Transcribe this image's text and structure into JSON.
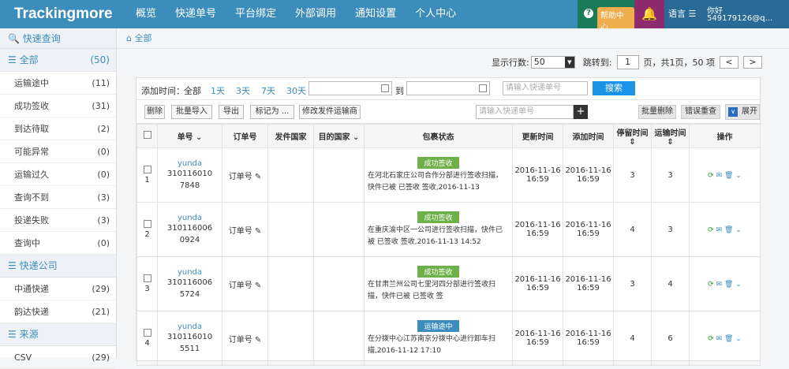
{
  "header": {
    "logo": "Trackingmore",
    "nav": [
      "概览",
      "快递单号",
      "平台绑定",
      "外部调用",
      "通知设置",
      "个人中心"
    ],
    "help": "帮助中心",
    "lang": "语言",
    "user_greeting": "你好",
    "user_email": "549179126@q..."
  },
  "sidebar": {
    "quick": "快速查询",
    "all": {
      "label": "全部",
      "count": "(50)"
    },
    "status_items": [
      {
        "label": "运输途中",
        "count": "(11)"
      },
      {
        "label": "成功签收",
        "count": "(31)"
      },
      {
        "label": "到达待取",
        "count": "(2)"
      },
      {
        "label": "可能异常",
        "count": "(0)"
      },
      {
        "label": "运输过久",
        "count": "(0)"
      },
      {
        "label": "查询不到",
        "count": "(3)"
      },
      {
        "label": "投递失败",
        "count": "(3)"
      },
      {
        "label": "查询中",
        "count": "(0)"
      }
    ],
    "carrier_group": "快递公司",
    "carriers": [
      {
        "label": "中通快递",
        "count": "(29)"
      },
      {
        "label": "韵达快递",
        "count": "(21)"
      }
    ],
    "source_group": "来源",
    "sources": [
      {
        "label": "CSV",
        "count": "(29)"
      }
    ]
  },
  "breadcrumb": "全部",
  "pager": {
    "rows_label": "显示行数:",
    "rows_value": "50",
    "jump_label": "跳转到:",
    "page_value": "1",
    "page_info": "页，共1页，50 项",
    "prev": "<",
    "next": ">"
  },
  "filter": {
    "label": "添加时间：",
    "quick": [
      "全部",
      "1天",
      "3天",
      "7天",
      "30天"
    ],
    "to": "到",
    "search_placeholder": "请输入快递单号",
    "search_btn": "搜索"
  },
  "toolbar": {
    "delete": "删除",
    "batch_import": "批量导入",
    "export": "导出",
    "mark_as": "标记为 ...",
    "modify_carrier": "修改发件运输商",
    "search_placeholder": "请输入快递单号",
    "plus": "+",
    "batch_delete": "批量删除",
    "error_recheck": "错误重查",
    "expand": "展开"
  },
  "table": {
    "headers": [
      "单号",
      "订单号",
      "发件国家",
      "目的国家",
      "包裹状态",
      "更新时间",
      "添加时间",
      "停留时间",
      "运输时间",
      "操作"
    ],
    "rows": [
      {
        "no": "1",
        "carrier": "yunda",
        "tracking": "3101160107848",
        "order": "订单号",
        "tag": "成功签收",
        "tag_type": "ok",
        "status": "在河北石家庄公司合作分部进行签收扫描，快件已被 已签收 签收,2016-11-13",
        "updated": "2016-11-16 16:59",
        "added": "2016-11-16 16:59",
        "stay": "3",
        "transit": "3"
      },
      {
        "no": "2",
        "carrier": "yunda",
        "tracking": "3101160060924",
        "order": "订单号",
        "tag": "成功签收",
        "tag_type": "ok",
        "status": "在重庆渝中区一公司进行签收扫描，快件已被 已签收 签收,2016-11-13 14:52",
        "updated": "2016-11-16 16:59",
        "added": "2016-11-16 16:59",
        "stay": "4",
        "transit": "3"
      },
      {
        "no": "3",
        "carrier": "yunda",
        "tracking": "3101160065724",
        "order": "订单号",
        "tag": "成功签收",
        "tag_type": "ok",
        "status": "在甘肃兰州公司七里河四分部进行签收扫描，快件已被 已签收 签",
        "updated": "2016-11-16 16:59",
        "added": "2016-11-16 16:59",
        "stay": "3",
        "transit": "4"
      },
      {
        "no": "4",
        "carrier": "yunda",
        "tracking": "3101160105511",
        "order": "订单号",
        "tag": "运输途中",
        "tag_type": "go",
        "status": "在分拨中心江苏南京分拨中心进行卸车扫描,2016-11-12 17:10",
        "updated": "2016-11-16 16:59",
        "added": "2016-11-16 16:59",
        "stay": "4",
        "transit": "6"
      }
    ]
  }
}
